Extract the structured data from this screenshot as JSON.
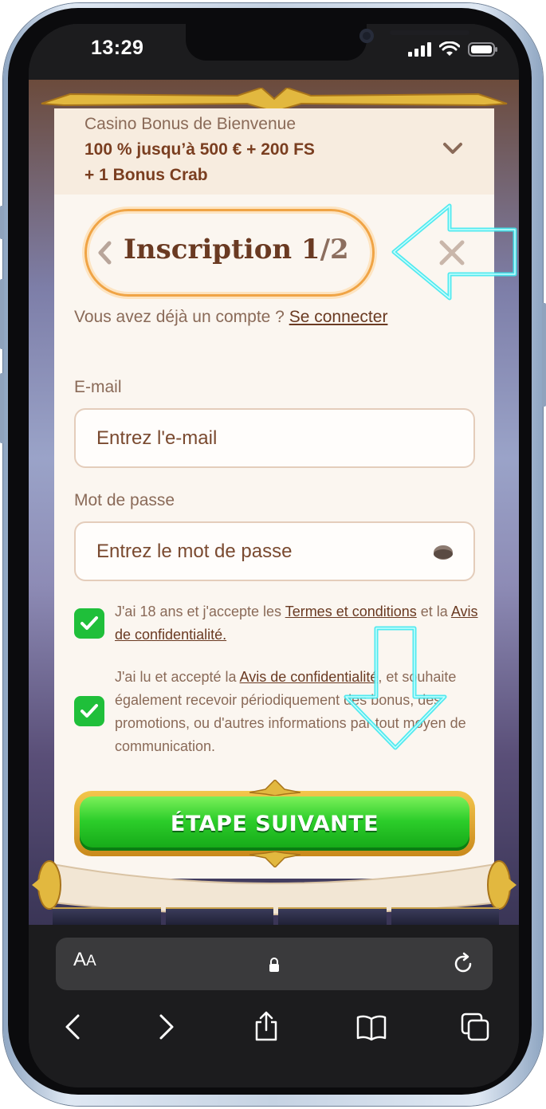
{
  "status_bar": {
    "time": "13:29"
  },
  "bonus": {
    "label": "Casino Bonus de Bienvenue",
    "line1": "100 % jusqu’à 500 € + 200 FS",
    "line2": "+ 1 Bonus Crab"
  },
  "signup": {
    "title": "Inscription 1",
    "title_step": "/2",
    "already_account": "Vous avez déjà un compte ?",
    "login_link": "Se connecter",
    "email_label": "E-mail",
    "email_placeholder": "Entrez l'e-mail",
    "password_label": "Mot de passe",
    "password_placeholder": "Entrez le mot de passe",
    "consent1": {
      "checked": true,
      "text_before": "J'ai 18 ans et j'accepte les",
      "terms_link": "Termes et conditions",
      "text_mid": "et la",
      "privacy_link": "Avis de confidentialité."
    },
    "consent2": {
      "checked": true,
      "text_before": "J'ai lu et accepté la",
      "privacy_link": "Avis de confidentialité",
      "text_after": ", et souhaite également recevoir périodiquement des bonus, des promotions, ou d'autres informations par tout moyen de communication."
    },
    "next_button": "ÉTAPE SUIVANTE"
  },
  "browser": {
    "aa_label": "A",
    "aa_small": "A",
    "icons": [
      "lock-icon",
      "reload-icon",
      "back-icon",
      "forward-icon",
      "share-icon",
      "bookmarks-icon",
      "tabs-icon"
    ]
  },
  "colors": {
    "accent_brown": "#6a3a22",
    "checkbox_green": "#1fbf3a",
    "annotation_cyan": "#3fe8ee",
    "title_outline": "#f0a445"
  }
}
